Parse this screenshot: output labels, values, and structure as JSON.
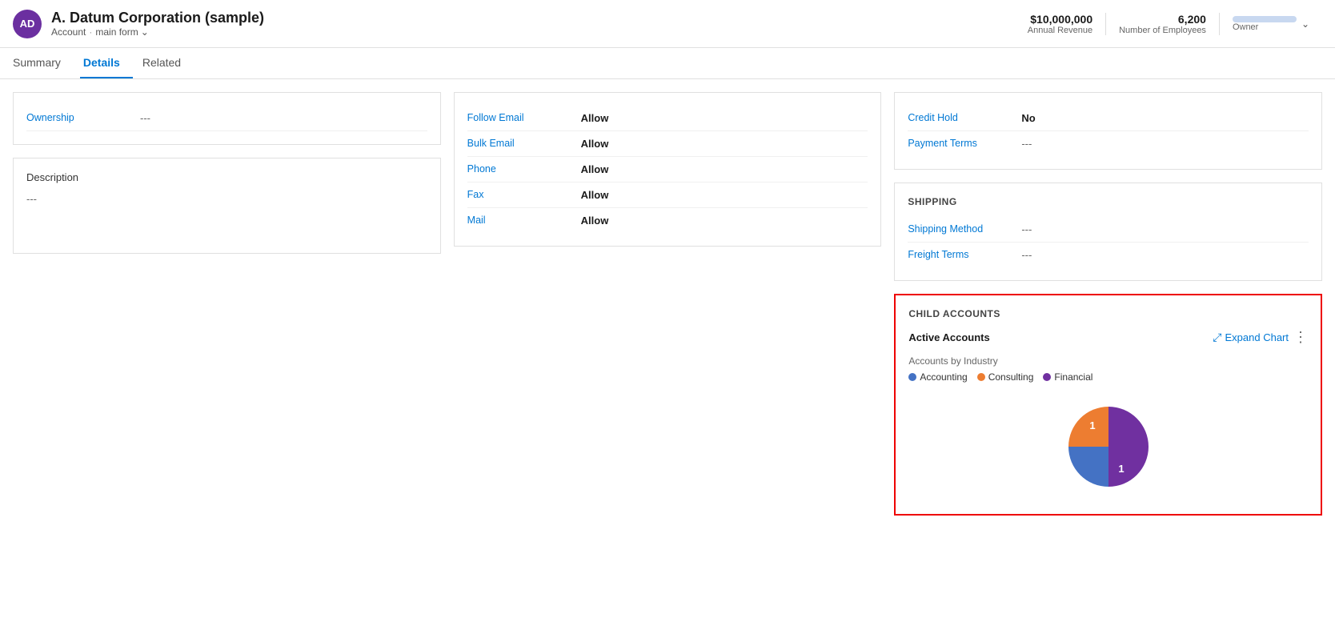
{
  "header": {
    "avatar_initials": "AD",
    "title": "A. Datum Corporation (sample)",
    "subtitle_type": "Account",
    "subtitle_sep": "·",
    "subtitle_form": "main form",
    "annual_revenue_label": "Annual Revenue",
    "annual_revenue_value": "$10,000,000",
    "employees_label": "Number of Employees",
    "employees_value": "6,200",
    "owner_label": "Owner"
  },
  "nav": {
    "tabs": [
      {
        "id": "summary",
        "label": "Summary"
      },
      {
        "id": "details",
        "label": "Details",
        "active": true
      },
      {
        "id": "related",
        "label": "Related"
      }
    ]
  },
  "left_col": {
    "ownership": {
      "label": "Ownership",
      "value": "---"
    },
    "description": {
      "title": "Description",
      "value": "---"
    }
  },
  "middle_col": {
    "contact_preferences": {
      "fields": [
        {
          "label": "Follow Email",
          "value": "Allow"
        },
        {
          "label": "Bulk Email",
          "value": "Allow"
        },
        {
          "label": "Phone",
          "value": "Allow"
        },
        {
          "label": "Fax",
          "value": "Allow"
        },
        {
          "label": "Mail",
          "value": "Allow"
        }
      ]
    }
  },
  "right_col": {
    "billing": {
      "fields": [
        {
          "label": "Credit Hold",
          "value": "No"
        },
        {
          "label": "Payment Terms",
          "value": "---"
        }
      ]
    },
    "shipping": {
      "title": "SHIPPING",
      "fields": [
        {
          "label": "Shipping Method",
          "value": "---"
        },
        {
          "label": "Freight Terms",
          "value": "---"
        }
      ]
    },
    "child_accounts": {
      "section_title": "CHILD ACCOUNTS",
      "chart_title": "Active Accounts",
      "chart_subtitle": "Accounts by Industry",
      "expand_label": "Expand Chart",
      "legend": [
        {
          "label": "Accounting",
          "color": "#4472c4"
        },
        {
          "label": "Consulting",
          "color": "#ed7d31"
        },
        {
          "label": "Financial",
          "color": "#7030a0"
        }
      ],
      "pie_data": [
        {
          "label": "Accounting",
          "value": 1,
          "color": "#4472c4"
        },
        {
          "label": "Consulting",
          "value": 1,
          "color": "#ed7d31"
        },
        {
          "label": "Financial",
          "value": 2,
          "color": "#7030a0"
        }
      ]
    }
  }
}
